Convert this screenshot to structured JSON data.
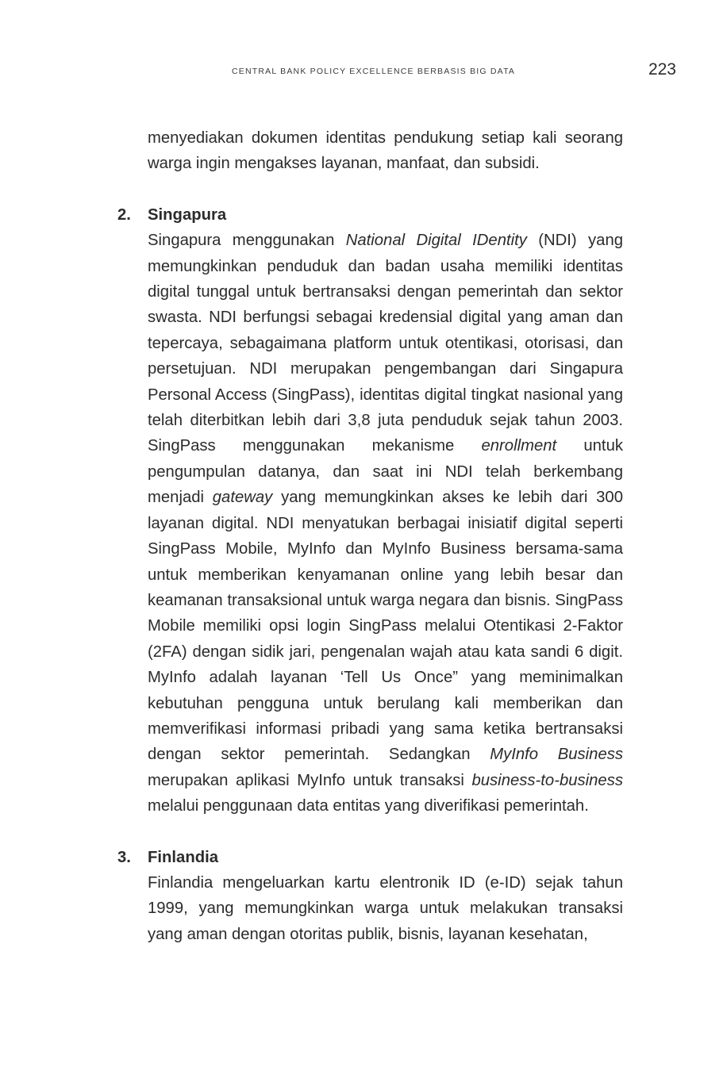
{
  "header": {
    "running_title": "CENTRAL BANK POLICY EXCELLENCE BERBASIS BIG DATA",
    "page_number": "223"
  },
  "intro": {
    "text": "menyediakan dokumen identitas pendukung setiap kali seorang warga ingin mengakses layanan, manfaat, dan subsidi."
  },
  "section_singapura": {
    "number": "2.",
    "title": "Singapura",
    "p1_a": "Singapura menggunakan ",
    "p1_i1": "National Digital IDentity",
    "p1_b": " (NDI) yang memungkinkan penduduk dan badan usaha memiliki identitas digital tunggal untuk bertransaksi dengan pemerintah dan sektor swasta. NDI berfungsi sebagai kredensial digital yang aman dan tepercaya, sebagaimana platform untuk otentikasi, otorisasi, dan persetujuan. NDI merupakan pengembangan dari Singapura Personal Access (SingPass), identitas digital tingkat nasional yang telah diterbitkan lebih dari 3,8 juta penduduk sejak tahun 2003. SingPass menggunakan mekanisme ",
    "p1_i2": "enrollment",
    "p1_c": " untuk pengumpulan datanya, dan saat ini NDI telah berkembang menjadi ",
    "p1_i3": "gateway",
    "p1_d": " yang memungkinkan akses ke lebih dari 300 layanan digital. NDI menyatukan berbagai inisiatif digital seperti SingPass Mobile, MyInfo dan MyInfo Business bersama-sama untuk memberikan kenyamanan online yang lebih besar dan keamanan transaksional untuk warga negara dan bisnis. SingPass Mobile memiliki opsi login SingPass melalui Otentikasi 2-Faktor (2FA) dengan sidik jari, pengenalan wajah atau kata sandi 6 digit. MyInfo adalah layanan ‘Tell Us Once” yang meminimalkan kebutuhan pengguna untuk berulang kali memberikan dan memverifikasi informasi pribadi yang sama ketika bertransaksi dengan sektor pemerintah. Sedangkan ",
    "p1_i4": "MyInfo Business",
    "p1_e": " merupakan aplikasi MyInfo untuk transaksi ",
    "p1_i5": "business-to-business",
    "p1_f": " melalui penggunaan data entitas yang diverifikasi pemerintah."
  },
  "section_finlandia": {
    "number": "3.",
    "title": "Finlandia",
    "p1": "Finlandia mengeluarkan kartu elentronik ID (e-ID) sejak tahun 1999, yang memungkinkan warga untuk melakukan transaksi yang aman dengan otoritas publik, bisnis, layanan kesehatan,"
  }
}
